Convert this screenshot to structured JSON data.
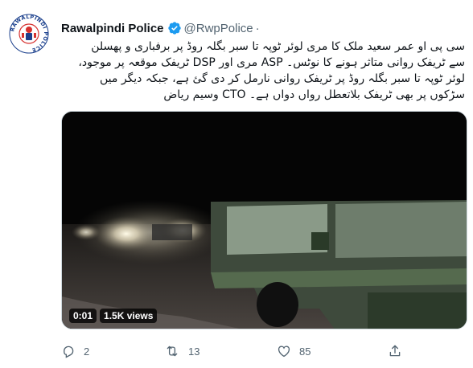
{
  "author": {
    "display_name": "Rawalpindi Police",
    "handle": "@RwpPolice",
    "separator": "·",
    "avatar_text": "RAWALPINDI POLICE",
    "avatar_icon": "police-badge-icon",
    "verified_icon": "verified-badge-icon",
    "verified_color": "#1d9bf0"
  },
  "tweet": {
    "lines": [
      "سی پی او عمر سعید ملک کا مری لوئر ٹوپہ تا سبر بگلہ روڈ پر برفباری و پھسلن",
      "سے ٹریفک روانی متاثر ہونے کا نوٹس۔ ASP مری اور DSP ٹریفک موقعہ پر موجود،",
      "لوئر ٹوپہ تا سبر بگلہ روڈ پر ٹریفک روانی نارمل کر دی گئ ہے، جبکہ دیگر میں",
      "سڑکوں پر بھی ٹریفک بلاتعطل رواں دواں ہے۔ CTO وسیم ریاض"
    ]
  },
  "media": {
    "type": "video",
    "time": "0:01",
    "views": "1.5K views"
  },
  "actions": {
    "reply": {
      "icon": "reply-icon",
      "count": "2"
    },
    "retweet": {
      "icon": "retweet-icon",
      "count": "13"
    },
    "like": {
      "icon": "heart-icon",
      "count": "85"
    },
    "share": {
      "icon": "share-icon"
    }
  },
  "colors": {
    "text": "#0f1419",
    "muted": "#536471",
    "border": "#cfd9de",
    "verified": "#1d9bf0",
    "badge_red": "#d6312f",
    "badge_blue": "#1a3f8c"
  }
}
